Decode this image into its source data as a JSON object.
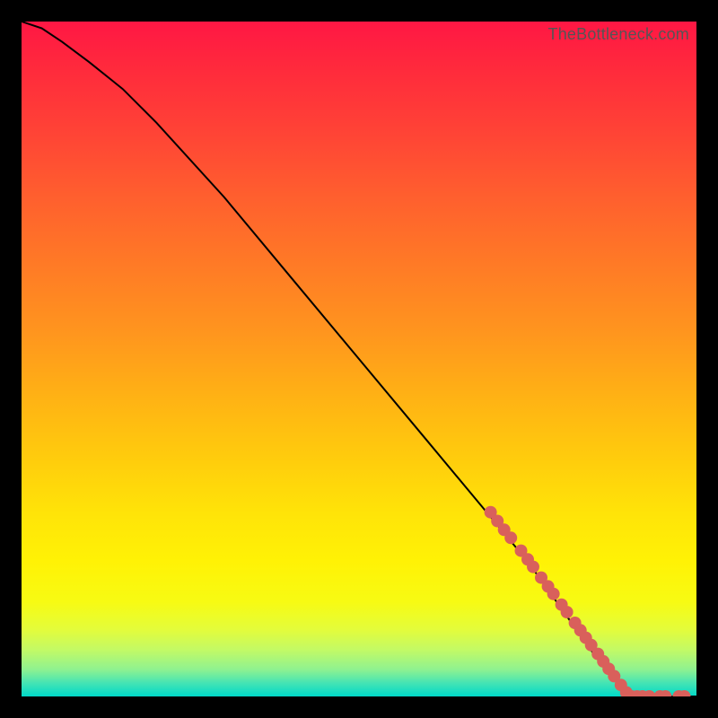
{
  "watermark": "TheBottleneck.com",
  "chart_data": {
    "type": "line",
    "title": "",
    "xlabel": "",
    "ylabel": "",
    "xlim": [
      0,
      100
    ],
    "ylim": [
      0,
      100
    ],
    "grid": false,
    "legend": false,
    "series": [
      {
        "name": "curve",
        "x": [
          0,
          3,
          6,
          10,
          15,
          20,
          30,
          40,
          50,
          60,
          70,
          75,
          80,
          85,
          90,
          95,
          100
        ],
        "y": [
          100,
          99,
          97,
          94,
          90,
          85,
          74,
          62,
          50,
          38,
          26,
          20,
          13,
          6,
          0,
          0,
          0
        ]
      }
    ],
    "markers": [
      {
        "name": "dots",
        "color": "#d9605b",
        "radius": 7,
        "points": [
          {
            "x": 69.5,
            "y": 27.3
          },
          {
            "x": 70.5,
            "y": 26.0
          },
          {
            "x": 71.5,
            "y": 24.7
          },
          {
            "x": 72.5,
            "y": 23.5
          },
          {
            "x": 74.0,
            "y": 21.6
          },
          {
            "x": 75.0,
            "y": 20.3
          },
          {
            "x": 75.8,
            "y": 19.2
          },
          {
            "x": 77.0,
            "y": 17.6
          },
          {
            "x": 78.0,
            "y": 16.3
          },
          {
            "x": 78.8,
            "y": 15.2
          },
          {
            "x": 80.0,
            "y": 13.6
          },
          {
            "x": 80.8,
            "y": 12.5
          },
          {
            "x": 82.0,
            "y": 10.9
          },
          {
            "x": 82.8,
            "y": 9.8
          },
          {
            "x": 83.6,
            "y": 8.7
          },
          {
            "x": 84.4,
            "y": 7.6
          },
          {
            "x": 85.4,
            "y": 6.3
          },
          {
            "x": 86.2,
            "y": 5.2
          },
          {
            "x": 87.0,
            "y": 4.1
          },
          {
            "x": 87.8,
            "y": 3.0
          },
          {
            "x": 88.8,
            "y": 1.7
          },
          {
            "x": 89.6,
            "y": 0.6
          },
          {
            "x": 90.4,
            "y": 0.0
          },
          {
            "x": 91.2,
            "y": 0.0
          },
          {
            "x": 92.0,
            "y": 0.0
          },
          {
            "x": 93.0,
            "y": 0.0
          },
          {
            "x": 94.6,
            "y": 0.0
          },
          {
            "x": 95.4,
            "y": 0.0
          },
          {
            "x": 97.4,
            "y": 0.0
          },
          {
            "x": 98.2,
            "y": 0.0
          }
        ]
      }
    ]
  }
}
